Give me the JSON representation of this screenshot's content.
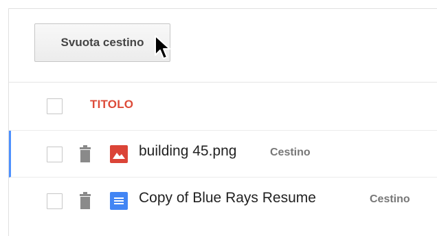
{
  "toolbar": {
    "empty_trash_label": "Svuota cestino"
  },
  "list": {
    "header": {
      "title_column": "TITOLO"
    },
    "rows": [
      {
        "name": "building 45.png",
        "status": "Cestino",
        "type_icon": "image-file-icon",
        "type_color": "#db4437",
        "selected": true
      },
      {
        "name": "Copy of Blue Rays Resume",
        "status": "Cestino",
        "type_icon": "document-file-icon",
        "type_color": "#4285f4",
        "selected": false
      }
    ]
  },
  "colors": {
    "title_accent": "#dd4b39",
    "selection_bar": "#4d90fe",
    "status_text": "#777777"
  }
}
